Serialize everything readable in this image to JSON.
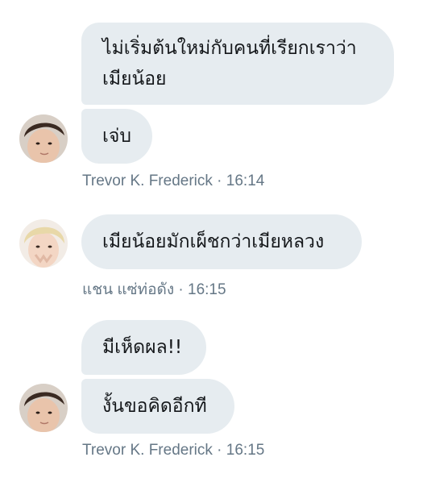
{
  "conversation": {
    "messages": [
      {
        "lines": [
          "ไม่เริ่มต้นใหม่กับคนที่เรียกเราว่า",
          "เมียน้อย"
        ]
      },
      {
        "lines": [
          "เจ่บ"
        ]
      },
      {
        "lines": [
          "เมียน้อยมักเผ็ชกว่าเมียหลวง"
        ]
      },
      {
        "lines": [
          "มีเห็ดผล!!"
        ]
      },
      {
        "lines": [
          "งั้นขอคิดอีกที"
        ]
      }
    ],
    "meta": [
      {
        "sender": "Trevor K. Frederick",
        "separator": "·",
        "time": "16:14"
      },
      {
        "sender": "แชน แซ่ท่อดัง",
        "separator": "·",
        "time": "16:15"
      },
      {
        "sender": "Trevor K. Frederick",
        "separator": "·",
        "time": "16:15"
      }
    ]
  },
  "colors": {
    "bubble": "#e6ecf0",
    "text": "#14171a",
    "meta": "#657786"
  }
}
